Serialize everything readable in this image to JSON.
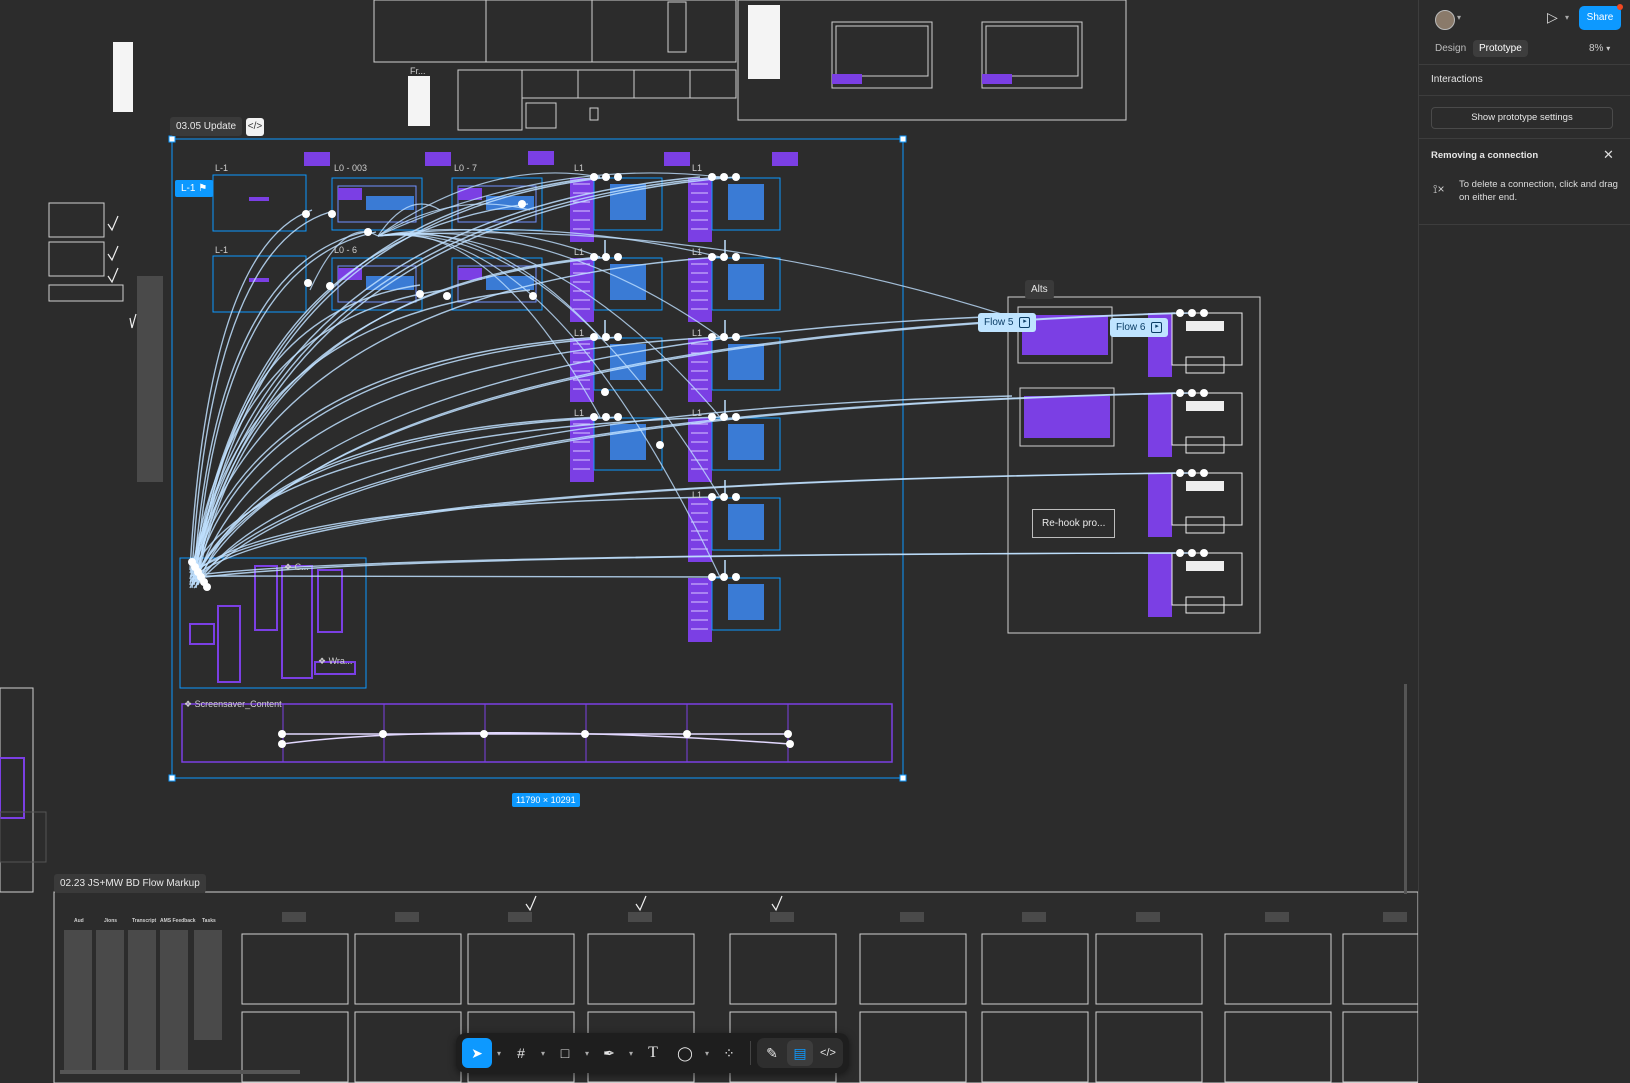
{
  "canvas": {
    "section_main_label": "03.05 Update",
    "section_main_size": "11790 × 10291",
    "section_bottom_label": "02.23 JS+MW BD Flow Markup",
    "section_alts_label": "Alts",
    "flow5_label": "Flow 5",
    "flow6_label": "Flow 6",
    "l_minus1_chip": "L-1",
    "frame_labels": [
      "L-1",
      "L0 - 003",
      "L0 - 7",
      "L1",
      "L1",
      "L-1",
      "L0 - 6",
      "L1",
      "L1",
      "L1",
      "L1",
      "L1",
      "L1",
      "L1"
    ],
    "component_screensaver": "❖ Screensaver_Content",
    "component_c": "❖ C...",
    "component_wra": "❖ Wra...",
    "frame_fr": "Fr...",
    "rehook_label": "Re-hook pro...",
    "bottom_col_labels": [
      "Aud",
      "Jions",
      "Transcript",
      "AMS Feedback",
      "Tasks"
    ]
  },
  "toolbar": {
    "tools": [
      {
        "name": "move-tool",
        "icon": "cursor-icon",
        "active": true
      },
      {
        "name": "frame-tool",
        "icon": "frame-icon",
        "active": false
      },
      {
        "name": "shape-tool",
        "icon": "rectangle-icon",
        "active": false
      },
      {
        "name": "pen-tool",
        "icon": "pen-icon",
        "active": false
      },
      {
        "name": "text-tool",
        "icon": "text-icon",
        "active": false
      },
      {
        "name": "comment-tool",
        "icon": "comment-icon",
        "active": false
      },
      {
        "name": "actions-tool",
        "icon": "components-icon",
        "active": false
      }
    ],
    "modes": [
      "draw-mode",
      "design-mode",
      "dev-mode"
    ]
  },
  "panel": {
    "tabs": [
      "Design",
      "Prototype"
    ],
    "active_tab": "Prototype",
    "zoom": "8%",
    "share_label": "Share",
    "interactions_title": "Interactions",
    "show_settings_label": "Show prototype settings",
    "removing_title": "Removing a connection",
    "removing_hint": "To delete a connection, click and drag on either end.",
    "help_label": "?"
  }
}
